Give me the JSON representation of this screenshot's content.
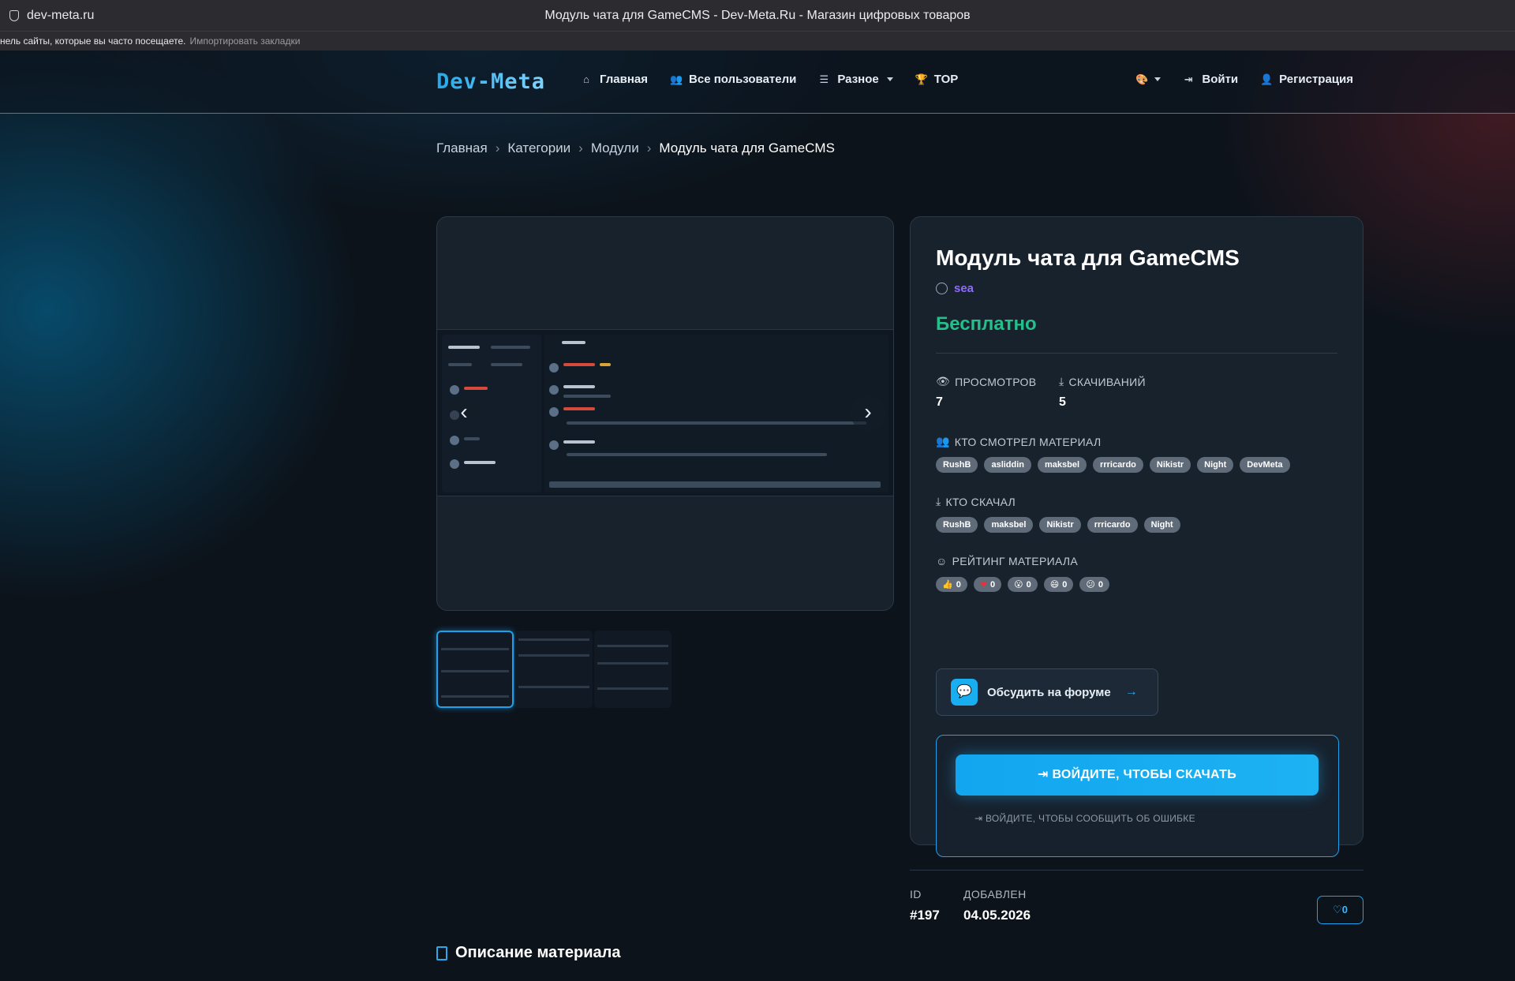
{
  "browser": {
    "url": "dev-meta.ru",
    "window_title": "Модуль чата для GameCMS - Dev-Meta.Ru - Магазин цифровых товаров",
    "bookmarks_hint": "нель сайты, которые вы часто посещаете.",
    "bookmarks_import": "Импортировать закладки"
  },
  "nav": {
    "logo": "Dev-Meta",
    "items": [
      {
        "label": "Главная",
        "icon": "home-icon"
      },
      {
        "label": "Все пользователи",
        "icon": "users-icon"
      },
      {
        "label": "Разное",
        "icon": "list-icon"
      },
      {
        "label": "TOP",
        "icon": "trophy-icon"
      }
    ],
    "login": "Войти",
    "register": "Регистрация"
  },
  "breadcrumb": [
    "Главная",
    "Категории",
    "Модули",
    "Модуль чата для GameCMS"
  ],
  "product": {
    "title": "Модуль чата для GameCMS",
    "author": "sea",
    "price": "Бесплатно",
    "views_label": "ПРОСМОТРОВ",
    "views": "7",
    "downloads_label": "СКАЧИВАНИЙ",
    "downloads": "5",
    "viewers_label": "КТО СМОТРЕЛ МАТЕРИАЛ",
    "viewers": [
      "RushB",
      "asliddin",
      "maksbel",
      "rrricardo",
      "Nikistr",
      "Night",
      "DevMeta"
    ],
    "downloaders_label": "КТО СКАЧАЛ",
    "downloaders": [
      "RushB",
      "maksbel",
      "Nikistr",
      "rrricardo",
      "Night"
    ],
    "rating_label": "РЕЙТИНГ МАТЕРИАЛА",
    "reactions": [
      {
        "icon": "👍",
        "count": "0"
      },
      {
        "icon": "❤",
        "count": "0"
      },
      {
        "icon": "😮",
        "count": "0"
      },
      {
        "icon": "😄",
        "count": "0"
      },
      {
        "icon": "😕",
        "count": "0"
      }
    ],
    "forum_button": "Обсудить на форуме",
    "download_button": "ВОЙДИТЕ, ЧТОБЫ СКАЧАТЬ",
    "report_link": "ВОЙДИТЕ, ЧТОБЫ СООБЩИТЬ ОБ ОШИБКЕ"
  },
  "meta": {
    "id_label": "ID",
    "id": "#197",
    "added_label": "ДОБАВЛЕН",
    "added": "04.05.2026",
    "likes": "0"
  },
  "description_title": "Описание материала",
  "colors": {
    "accent": "#1ea0ea",
    "price": "#22c08a",
    "author": "#8f6bff"
  }
}
